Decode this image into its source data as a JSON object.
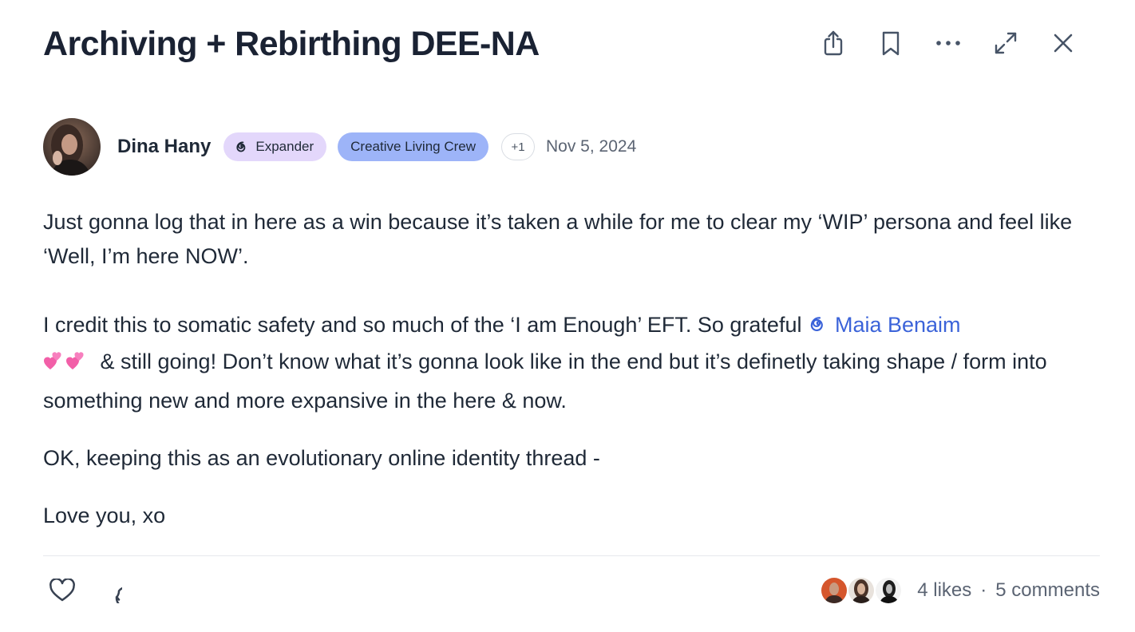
{
  "post": {
    "title": "Archiving + Rebirthing DEE-NA"
  },
  "header_actions": [
    {
      "icon": "share-icon"
    },
    {
      "icon": "bookmark-icon"
    },
    {
      "icon": "more-options-icon"
    },
    {
      "icon": "expand-icon"
    },
    {
      "icon": "close-icon"
    }
  ],
  "author": {
    "name": "Dina Hany",
    "badges": [
      "Expander",
      "Creative Living Crew"
    ],
    "extra_badges": "+1",
    "date": "Nov 5, 2024"
  },
  "body": {
    "p1": "Just gonna log that in here as a win because it’s taken a while for me to clear my ‘WIP’ persona and feel like ‘Well, I’m here NOW’.",
    "p2_before_mention": "I credit this to somatic safety and so much of the ‘I am Enough’ EFT. So grateful ",
    "mention": "Maia Benaim",
    "p2_after_mention": " & still going! Don’t know what it’s gonna look like in the end but it’s definetly taking shape / form into something new and more expansive in the here & now.",
    "p3": "OK, keeping this as an evolutionary online identity thread -",
    "p4": "Love you, xo"
  },
  "footer": {
    "likes": "4 likes",
    "separator": "·",
    "comments": "5 comments"
  },
  "colors": {
    "expander_badge": "#e3d7fb",
    "crew_badge": "#9db4f8",
    "mention": "#3b63d9",
    "title": "#1a2233"
  }
}
